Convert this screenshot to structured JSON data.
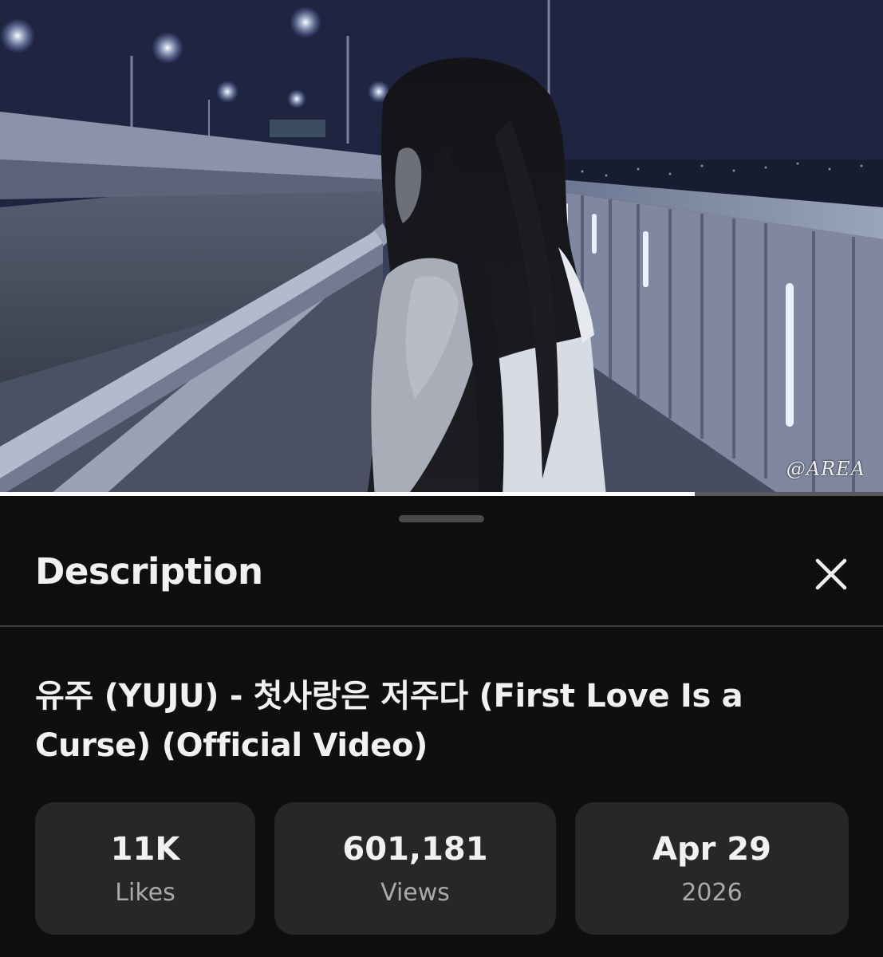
{
  "video": {
    "watermark": "@AREA",
    "progress_fraction": 0.787
  },
  "sheet": {
    "title": "Description",
    "close_icon": "close-icon"
  },
  "details": {
    "video_title": "유주 (YUJU) - 첫사랑은 저주다 (First Love Is a Curse) (Official Video)",
    "likes_value": "11K",
    "likes_label": "Likes",
    "views_value": "601,181",
    "views_label": "Views",
    "date_value": "Apr 29",
    "date_year": "2026"
  },
  "colors": {
    "background": "#0f0f0f",
    "card": "#272727",
    "text_primary": "#f1f1f1",
    "text_secondary": "#aaaaaa"
  }
}
